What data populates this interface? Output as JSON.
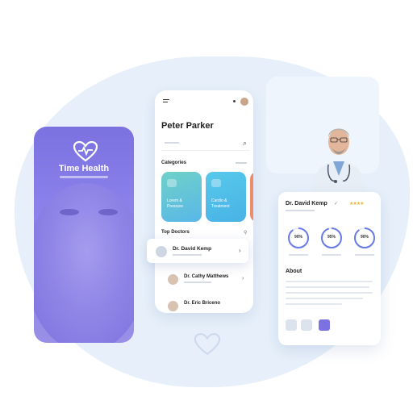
{
  "splash": {
    "app_name": "Time Health",
    "logo_icon": "heart-pulse-icon",
    "gradient": [
      "#7b71e0",
      "#9a8fe6"
    ]
  },
  "home": {
    "menu_icon": "hamburger-menu-icon",
    "user_name": "Peter Parker",
    "search_icon": "search-icon",
    "categories_label": "Categories",
    "categories": [
      {
        "label": "Lorem & Pressure",
        "color": "#7f8cf0",
        "icon": "dental-icon"
      },
      {
        "label": "Cardio & Treatment",
        "color": "#4ec9e6",
        "icon": "heart-icon"
      },
      {
        "label": "",
        "color": "#f08a6c",
        "icon": ""
      }
    ],
    "top_doctors_label": "Top Doctors",
    "doctors": [
      {
        "name": "Dr. David Kemp"
      },
      {
        "name": "Dr. Cathy Matthews"
      },
      {
        "name": "Dr. Eric Briceno"
      }
    ]
  },
  "profile": {
    "name": "Dr. David Kemp",
    "stats": [
      {
        "value": "90%",
        "fraction": 0.9,
        "color": "#6a7be8"
      },
      {
        "value": "95%",
        "fraction": 0.95,
        "color": "#6a7be8"
      },
      {
        "value": "90%",
        "fraction": 0.9,
        "color": "#6a7be8"
      }
    ],
    "about_label": "About",
    "rating": 4,
    "rating_max": 5,
    "stars": "★★★★"
  },
  "colors": {
    "background_blob": "#e7f0fa",
    "accent": "#6a7be8",
    "purple": "#7b71e0"
  }
}
